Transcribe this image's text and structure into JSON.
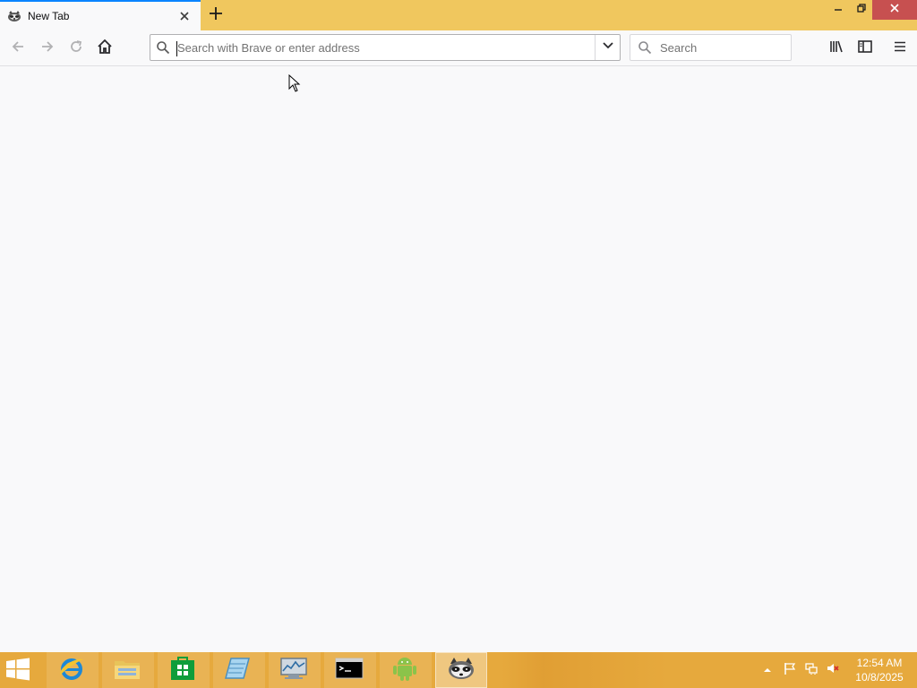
{
  "window": {
    "tab_title": "New Tab",
    "controls": {
      "minimize_icon": "minimize-icon",
      "maximize_icon": "restore-icon",
      "close_icon": "close-icon"
    }
  },
  "toolbar": {
    "back_icon": "back-arrow-icon",
    "forward_icon": "forward-arrow-icon",
    "reload_icon": "reload-icon",
    "home_icon": "home-icon",
    "library_icon": "library-icon",
    "sidebar_icon": "sidebar-icon",
    "menu_icon": "hamburger-menu-icon"
  },
  "urlbar": {
    "placeholder": "Search with Brave or enter address",
    "value": ""
  },
  "searchbar": {
    "placeholder": "Search",
    "value": ""
  },
  "taskbar": {
    "apps": [
      {
        "name": "internet-explorer",
        "icon": "internet-explorer-icon"
      },
      {
        "name": "file-explorer",
        "icon": "folder-icon"
      },
      {
        "name": "store",
        "icon": "store-icon"
      },
      {
        "name": "notepad",
        "icon": "notepad-icon"
      },
      {
        "name": "task-manager",
        "icon": "monitor-icon"
      },
      {
        "name": "command-prompt",
        "icon": "terminal-icon"
      },
      {
        "name": "android",
        "icon": "android-icon"
      },
      {
        "name": "browser",
        "icon": "raccoon-icon"
      }
    ],
    "clock": {
      "time": "12:54 AM",
      "date": "10/8/2025"
    }
  },
  "colors": {
    "titlebar": "#f0c75e",
    "taskbar": "#e6a93d",
    "tab_accent": "#0a84ff",
    "close_button": "#c75050",
    "background": "#f9f9fa"
  }
}
